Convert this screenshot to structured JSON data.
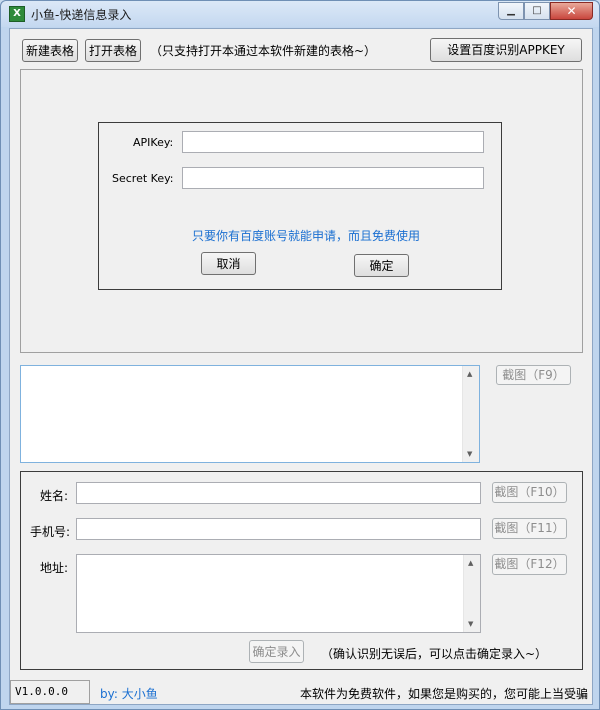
{
  "window": {
    "title": "小鱼-快递信息录入",
    "icon": "excel-icon",
    "controls": {
      "minimize": "▁",
      "maximize": "□",
      "close": "✕"
    }
  },
  "toolbar": {
    "new_table": "新建表格",
    "open_table": "打开表格",
    "hint": "（只支持打开本通过本软件新建的表格~）",
    "set_key": "设置百度识别APPKEY"
  },
  "dialog": {
    "api_key_label": "APIKey:",
    "api_key_value": "",
    "secret_key_label": "Secret Key:",
    "secret_key_value": "",
    "link_text": "只要你有百度账号就能申请，而且免费使用",
    "cancel": "取消",
    "confirm": "确定"
  },
  "ocr": {
    "text_value": "",
    "screenshot_button": "截图（F9）"
  },
  "form": {
    "name_label": "姓名:",
    "name_value": "",
    "name_screenshot": "截图（F10）",
    "phone_label": "手机号:",
    "phone_value": "",
    "phone_screenshot": "截图（F11）",
    "address_label": "地址:",
    "address_value": "",
    "address_screenshot": "截图（F12）",
    "submit": "确定录入",
    "submit_hint": "（确认识别无误后，可以点击确定录入~）"
  },
  "status": {
    "version": "V1.0.0.0",
    "author": "by: 大小鱼",
    "notice": "本软件为免费软件，如果您是购买的，您可能上当受骗"
  },
  "colors": {
    "link": "#1a6fd1"
  }
}
